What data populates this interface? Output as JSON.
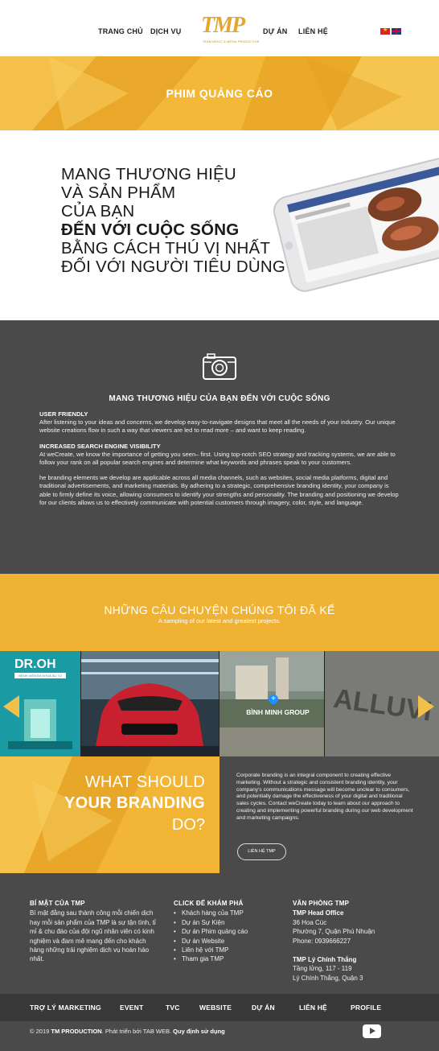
{
  "header": {
    "nav": [
      "TRANG CHỦ",
      "DỊCH VỤ",
      "DỰ ÁN",
      "LIÊN HỆ"
    ],
    "logo_text": "TMP",
    "logo_sub": "TEAM MAGIC & MEDIA PRODUCTION"
  },
  "hero": {
    "title": "PHIM QUẢNG CÁO"
  },
  "headline": {
    "lines": [
      "MANG THƯƠNG HIỆU",
      "VÀ SẢN PHẨM",
      "CỦA BẠN",
      "ĐẾN VỚI CUỘC SỐNG",
      "BẰNG CÁCH THÚ VỊ NHẤT",
      "ĐỐI VỚI NGƯỜI TIÊU DÙNG"
    ]
  },
  "dark_section": {
    "title": "MANG THƯƠNG HIỆU CỦA BẠN ĐẾN VỚI CUỘC SỐNG",
    "blocks": [
      {
        "heading": "USER FRIENDLY",
        "text": "After listening to your ideas and concerns, we develop easy-to-navigate designs that meet all the needs of your industry. Our unique website creations flow in such a way that viewers are led to read more – and want to keep reading."
      },
      {
        "heading": "INCREASED SEARCH ENGINE VISIBILITY",
        "text": "At weCreate, we know the importance of getting you seen– first. Using top-notch SEO strategy and tracking systems, we are able to follow your rank on all popular search engines and determine what keywords and phrases speak to your customers."
      },
      {
        "heading": "",
        "text": "he branding elements we develop are applicable across all media channels, such as websites, social media platforms, digital and traditional advertisements, and marketing materials. By adhering to a strategic, comprehensive branding identity, your company is able to firmly define its voice, allowing consumers to identify your strengths and personality. The branding and positioning we develop for our clients allows us to effectively communicate with potential customers through imagery, color, style, and language."
      }
    ]
  },
  "stories": {
    "title": "NHỮNG CÂU CHUYỆN CHÚNG TÔI ĐÃ KỂ",
    "subtitle": "A sampling of our latest and greatest projects."
  },
  "gallery": {
    "tile1_title": "DR.OH",
    "tile1_sub": "BỆNH VIỆN ĐA KHOA ÂU TÚ",
    "tile3_label": "BÌNH MINH GROUP",
    "plus": "+",
    "sign_text": "ALLUVI"
  },
  "branding": {
    "line1": "WHAT SHOULD",
    "line2": "YOUR BRANDING",
    "line3": "DO?",
    "text": "Corporate branding is an integral component to creating effective marketing. Without a strategic and consistent branding identity, your company's communications message will become unclear to consumers, and potentially damage the effectiveness of your digital and traditional sales cycles. Contact weCreate today to learn about our approach to creating and implementing powerful branding during our web development and marketing campaigns.",
    "button": "LIÊN HỆ TMP"
  },
  "footer": {
    "col1_title": "BÍ MẬT CỦA TMP",
    "col1_text": "Bí mật đằng sau thành công mỗi chiến dịch hay mỗi sản phẩm của TMP là sự tận tình, tỉ mỉ & chu đáo của đội ngũ nhân viên có kinh nghiệm và đam mê mang đến cho khách hàng những trải nghiệm dịch vụ hoàn hảo nhất.",
    "col2_title": "CLICK ĐỂ KHÁM PHÁ",
    "col2_items": [
      "Khách hàng của TMP",
      "Dự án Sự Kiện",
      "Dự án Phim quảng cáo",
      "Dự án Website",
      "Liên hệ với TMP",
      "Tham gia TMP"
    ],
    "col3_title": "VĂN PHÒNG TMP",
    "office1_name": "TMP Head Office",
    "office1_lines": [
      "36 Hoa Cúc",
      "Phường 7, Quận Phú Nhuận",
      "Phone: 0939666227"
    ],
    "office2_name": "TMP Lý Chính Thắng",
    "office2_lines": [
      "Tầng lửng, 117 - 119",
      "Lý Chính Thắng, Quận 3"
    ]
  },
  "bottom_nav": [
    "TRỢ LÝ MARKETING",
    "EVENT",
    "TVC",
    "WEBSITE",
    "DỰ ÁN",
    "LIÊN HỆ",
    "PROFILE"
  ],
  "copyright": {
    "prefix": "© 2019 ",
    "brand": "TM PRODUCTION",
    "middle": ". Phát triển bởi TAB WEB. ",
    "policy": "Quy định sử dụng"
  },
  "colors": {
    "accent": "#f0b232",
    "dark": "#4a4a4a",
    "darker": "#383838"
  }
}
